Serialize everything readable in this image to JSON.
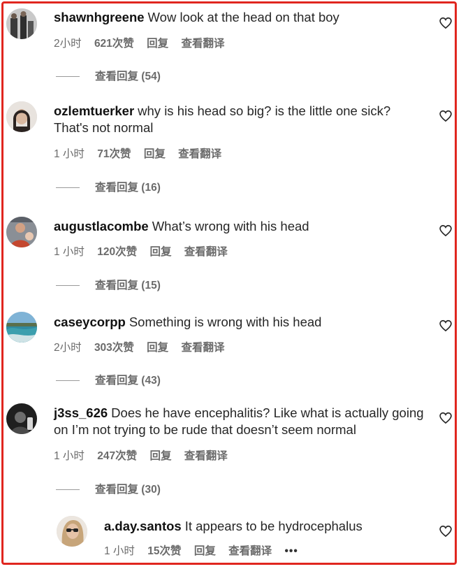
{
  "comments": [
    {
      "username": "shawnhgreene",
      "text": "Wow look at the head on that boy",
      "time": "2小时",
      "likes": "621次赞",
      "reply": "回复",
      "translate": "查看翻译",
      "view_replies": "查看回复 (54)"
    },
    {
      "username": "ozlemtuerker",
      "text": "why is his head so big? is the little one sick? That's not normal",
      "time": "1 小时",
      "likes": "71次赞",
      "reply": "回复",
      "translate": "查看翻译",
      "view_replies": "查看回复 (16)"
    },
    {
      "username": "augustlacombe",
      "text": "What’s wrong with his head",
      "time": "1 小时",
      "likes": "120次赞",
      "reply": "回复",
      "translate": "查看翻译",
      "view_replies": "查看回复 (15)"
    },
    {
      "username": "caseycorpp",
      "text": "Something is wrong with his head",
      "time": "2小时",
      "likes": "303次赞",
      "reply": "回复",
      "translate": "查看翻译",
      "view_replies": "查看回复 (43)"
    },
    {
      "username": "j3ss_626",
      "text": "Does he have encephalitis? Like what is actually going on I’m not trying to be rude that doesn’t seem normal",
      "time": "1 小时",
      "likes": "247次赞",
      "reply": "回复",
      "translate": "查看翻译",
      "view_replies": "查看回复 (30)"
    }
  ],
  "reply_comment": {
    "username": "a.day.santos",
    "text": "It appears to be hydrocephalus",
    "time": "1 小时",
    "likes": "15次赞",
    "reply": "回复",
    "translate": "查看翻译",
    "more": "•••"
  },
  "colors": {
    "border": "#e0261f",
    "meta": "#6b6b6b",
    "text": "#262626"
  },
  "icons": {
    "like": "heart-outline-icon",
    "more": "more-dots-icon"
  }
}
